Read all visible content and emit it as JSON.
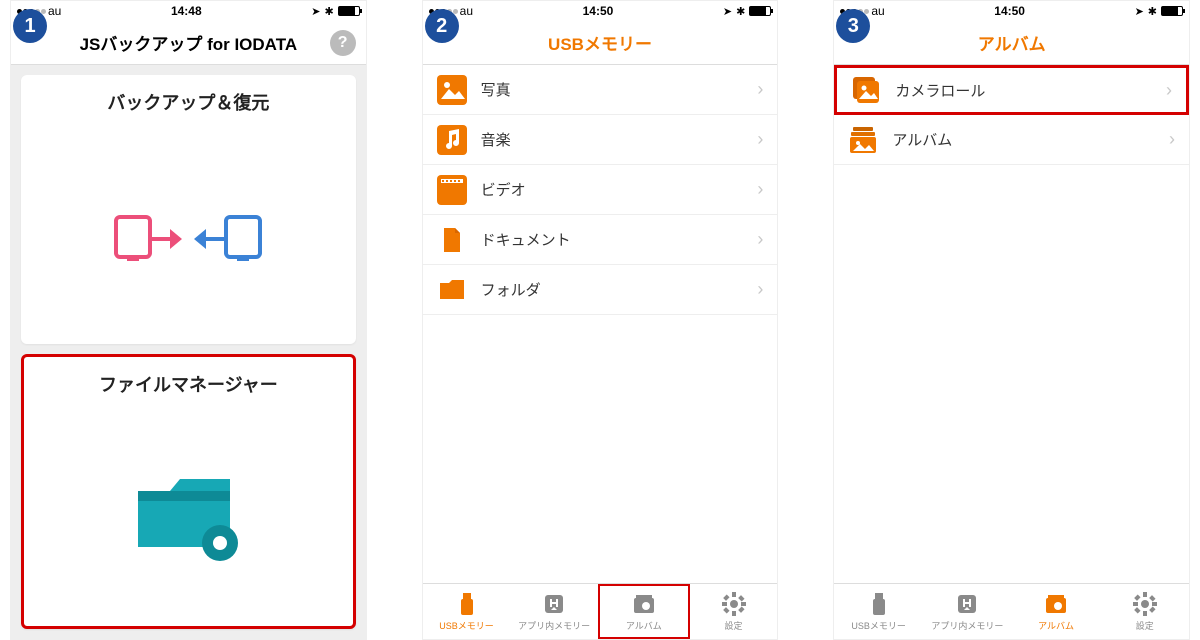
{
  "screens": [
    {
      "badge": "1",
      "status": {
        "carrier": "au",
        "time": "14:48"
      },
      "title": "JSバックアップ for IODATA",
      "card_backup": "バックアップ＆復元",
      "card_fm": "ファイルマネージャー"
    },
    {
      "badge": "2",
      "status": {
        "carrier": "au",
        "time": "14:50"
      },
      "title": "USBメモリー",
      "rows": [
        "写真",
        "音楽",
        "ビデオ",
        "ドキュメント",
        "フォルダ"
      ],
      "tabs": [
        "USBメモリー",
        "アプリ内メモリー",
        "アルバム",
        "設定"
      ]
    },
    {
      "badge": "3",
      "status": {
        "carrier": "au",
        "time": "14:50"
      },
      "title": "アルバム",
      "rows": [
        "カメラロール",
        "アルバム"
      ],
      "tabs": [
        "USBメモリー",
        "アプリ内メモリー",
        "アルバム",
        "設定"
      ]
    }
  ]
}
